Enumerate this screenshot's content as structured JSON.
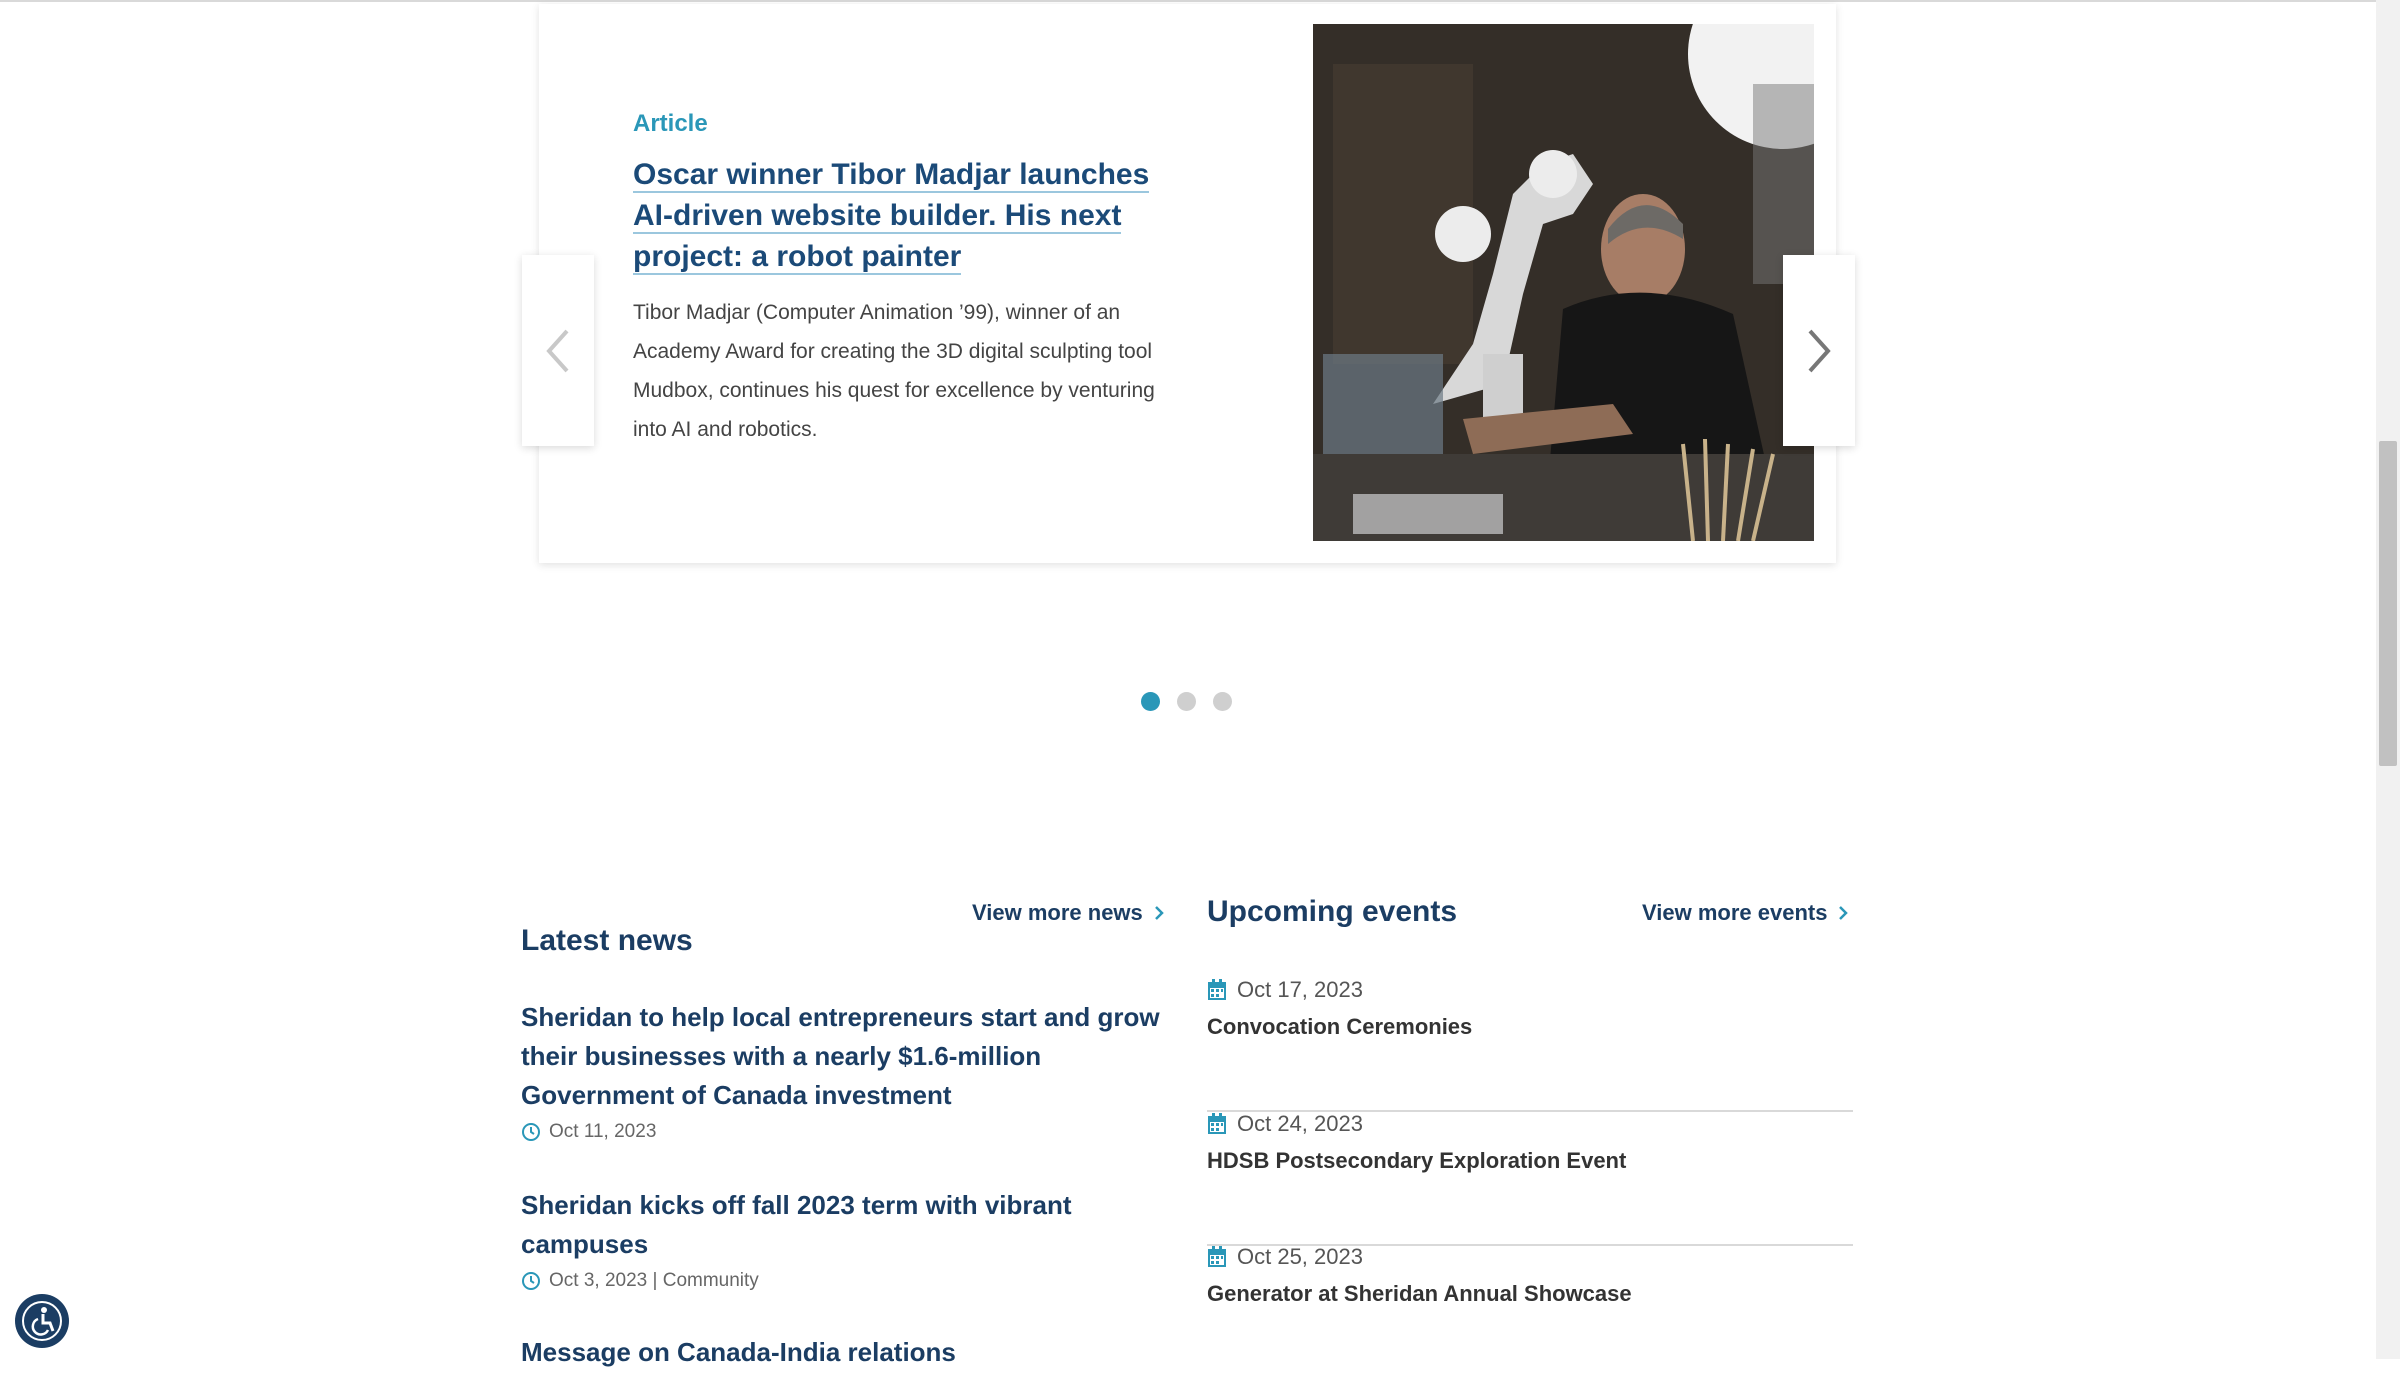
{
  "carousel": {
    "slide": {
      "type": "Article",
      "title": "Oscar winner Tibor Madjar launches AI-driven website builder. His next project: a robot painter",
      "description": "Tibor Madjar (Computer Animation ’99), winner of an Academy Award for creating the 3D digital sculpting tool Mudbox, continues his quest for excellence by venturing into AI and robotics."
    },
    "prev_icon": "chevron-left-icon",
    "next_icon": "chevron-right-icon",
    "dots_total": 3,
    "active_dot": 1
  },
  "news": {
    "heading": "Latest news",
    "more_label": "View more news",
    "items": [
      {
        "title": "Sheridan to help local entrepreneurs start and grow their businesses with a nearly $1.6-million Government of Canada investment",
        "meta": "Oct 11, 2023"
      },
      {
        "title": "Sheridan kicks off fall 2023 term with vibrant campuses",
        "meta": "Oct 3, 2023 | Community"
      },
      {
        "title": "Message on Canada-India relations",
        "meta": ""
      }
    ]
  },
  "events": {
    "heading": "Upcoming events",
    "more_label": "View more events",
    "items": [
      {
        "date": "Oct 17, 2023",
        "title": "Convocation Ceremonies"
      },
      {
        "date": "Oct 24, 2023",
        "title": "HDSB Postsecondary Exploration Event"
      },
      {
        "date": "Oct 25, 2023",
        "title": "Generator at Sheridan Annual Showcase"
      }
    ]
  },
  "colors": {
    "accent": "#2a97b8",
    "heading": "#1b3d63",
    "link": "#1b4a78"
  }
}
